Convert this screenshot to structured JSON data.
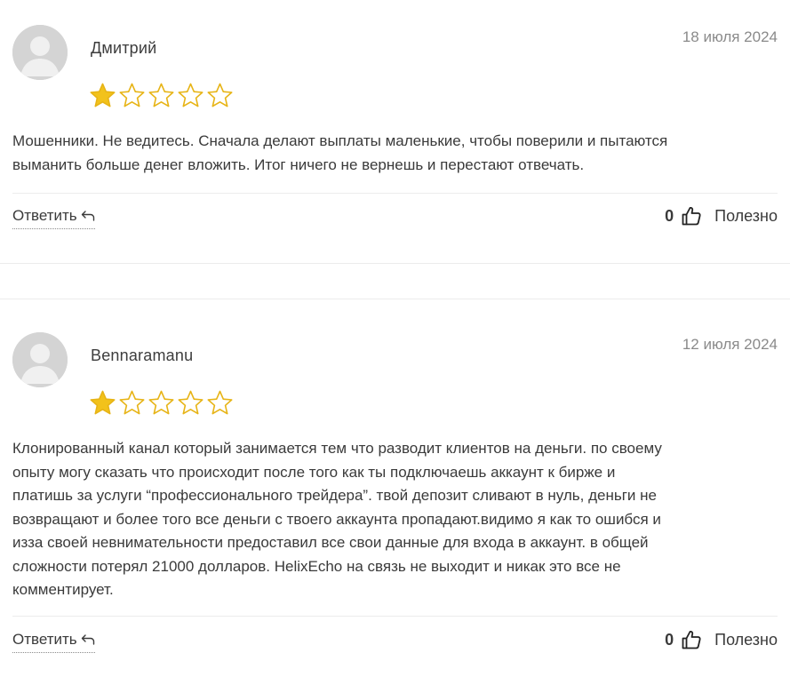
{
  "reviews": [
    {
      "author": "Дмитрий",
      "date": "18 июля 2024",
      "rating": 1,
      "max_rating": 5,
      "text_lines": [
        "Мошенники. Не ведитесь. Сначала делают выплаты маленькие, чтобы поверили и пытаются",
        "выманить больше денег вложить. Итог ничего не вернешь и перестают отвечать."
      ],
      "reply_label": "Ответить",
      "helpful_count": "0",
      "helpful_label": "Полезно"
    },
    {
      "author": "Bennaramanu",
      "date": "12 июля 2024",
      "rating": 1,
      "max_rating": 5,
      "text_lines": [
        "Клонированный канал который занимается тем что разводит клиентов на деньги. по своему",
        "опыту могу сказать что происходит после того как ты подключаешь аккаунт к бирже и",
        "платишь за услуги “профессионального трейдера”. твой депозит сливают в нуль, деньги не",
        "возвращают и более того все деньги с твоего аккаунта пропадают.видимо я как то ошибся и",
        "изза своей невнимательности предоставил все свои данные для входа в аккаунт. в общей",
        "сложности потерял 21000 долларов. HelixEcho на связь не выходит и никак это все не",
        "комментирует."
      ],
      "reply_label": "Ответить",
      "helpful_count": "0",
      "helpful_label": "Полезно"
    }
  ],
  "colors": {
    "star_filled": "#f2c21b",
    "star_outline": "#e7b416",
    "avatar_bg": "#d4d4d4",
    "avatar_fg": "#f0f0f0",
    "text": "#3a3a3a",
    "muted": "#8a8a8a",
    "divider": "#ececec"
  },
  "icons": {
    "avatar": "user-silhouette-icon",
    "star_filled": "star-filled-icon",
    "star_empty": "star-outline-icon",
    "reply": "reply-arrow-icon",
    "thumb": "thumbs-up-icon"
  }
}
